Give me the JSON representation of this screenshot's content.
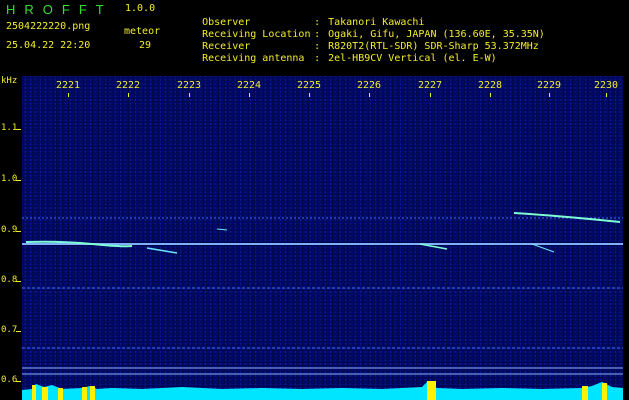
{
  "header": {
    "app_name": "HROFFT",
    "app_version": "1.0.0",
    "filename": "2504222220.png",
    "datetime": "25.04.22 22:20",
    "meteor_label": "meteor",
    "meteor_count": "29",
    "info": [
      {
        "key": "Observer",
        "sep": ":",
        "value": "Takanori Kawachi"
      },
      {
        "key": "Receiving Location",
        "sep": ":",
        "value": "Ogaki, Gifu, JAPAN (136.60E, 35.35N)"
      },
      {
        "key": "Receiver",
        "sep": ":",
        "value": "R820T2(RTL-SDR) SDR-Sharp 53.372MHz"
      },
      {
        "key": "Receiving antenna",
        "sep": ":",
        "value": "2el-HB9CV Vertical (el. E-W)"
      }
    ]
  },
  "spectrogram": {
    "y_unit": "kHz",
    "y_ticks": [
      "1.1",
      "1.0",
      "0.9",
      "0.8",
      "0.7",
      "0.6"
    ],
    "x_ticks": [
      "2221",
      "2222",
      "2223",
      "2224",
      "2225",
      "2226",
      "2227",
      "2228",
      "2229",
      "2230"
    ],
    "colors": {
      "background": "#000a6e",
      "carrier": "#7fb0ff",
      "echo": "#7fffd4",
      "level": "#00e5ff",
      "peak": "#fff200",
      "text": "#f2ee2a",
      "title": "#2fe12f"
    }
  }
}
